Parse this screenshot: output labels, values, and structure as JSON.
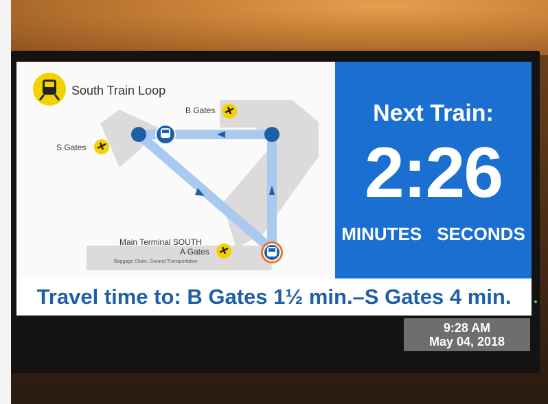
{
  "map": {
    "title": "South Train Loop",
    "labels": {
      "b_gates": "B Gates",
      "s_gates": "S Gates",
      "main_terminal": "Main Terminal SOUTH",
      "a_gates": "A Gates",
      "a_sub": "Baggage Claim, Ground Transportation"
    }
  },
  "next_train": {
    "title": "Next Train:",
    "countdown": "2:26",
    "minutes_label": "MINUTES",
    "seconds_label": "SECONDS"
  },
  "travel_time": "Travel time to: B Gates 1½ min.–S Gates 4 min.",
  "clock": {
    "time": "9:28 AM",
    "date": "May 04, 2018"
  },
  "colors": {
    "panel_blue": "#1a6fd1",
    "travel_text": "#1f5fa8",
    "track": "#a9c9ef",
    "node": "#1f5fa8",
    "airport_icon": "#f4d200"
  },
  "icons": [
    "train-icon",
    "airplane-icon"
  ]
}
